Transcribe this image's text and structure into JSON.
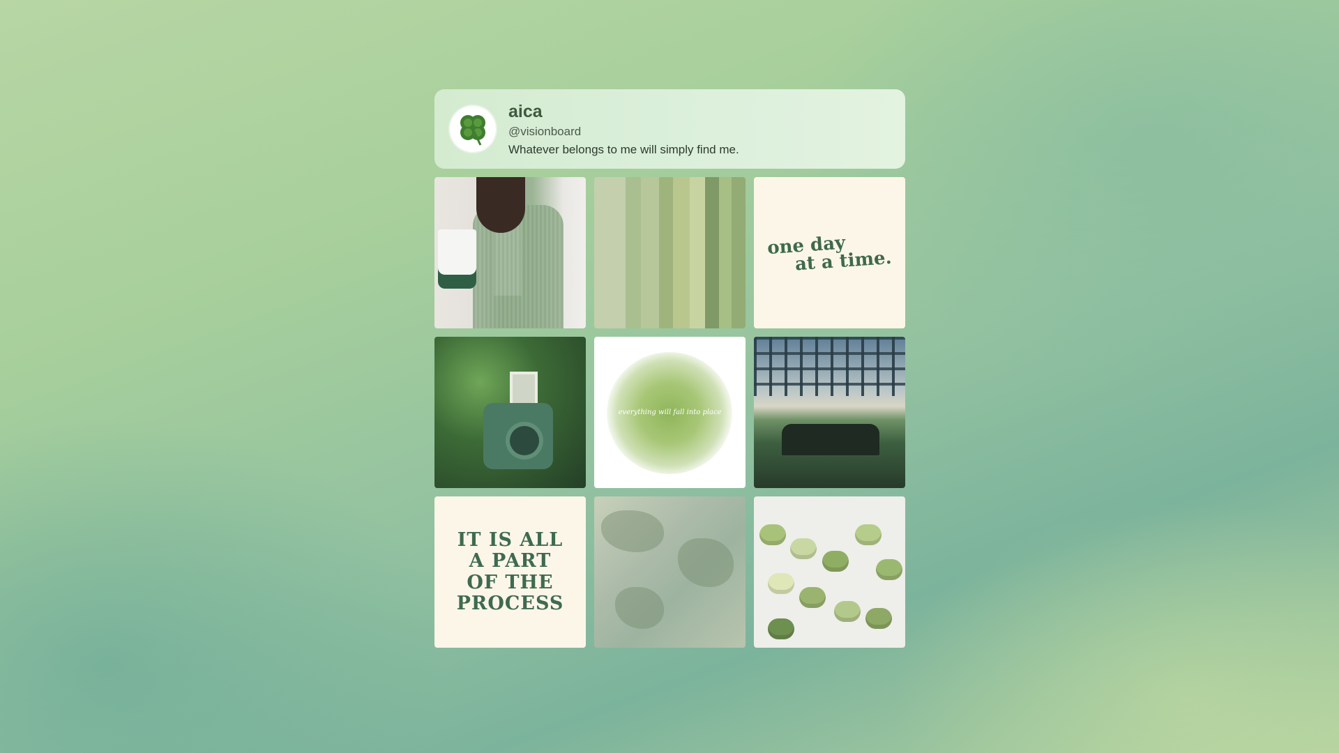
{
  "profile": {
    "name": "aica",
    "handle": "@visionboard",
    "bio": "Whatever belongs to me will simply find me."
  },
  "tiles": {
    "quote_one": [
      "one day",
      "at a time."
    ],
    "quote_two": "everything will fall into place",
    "quote_three": [
      "IT IS ALL",
      "A PART",
      "OF THE",
      "PROCESS"
    ]
  },
  "colors": {
    "accent": "#3f6a4a",
    "card_bg": "#dcf0dc",
    "cream": "#fcf6e9"
  }
}
